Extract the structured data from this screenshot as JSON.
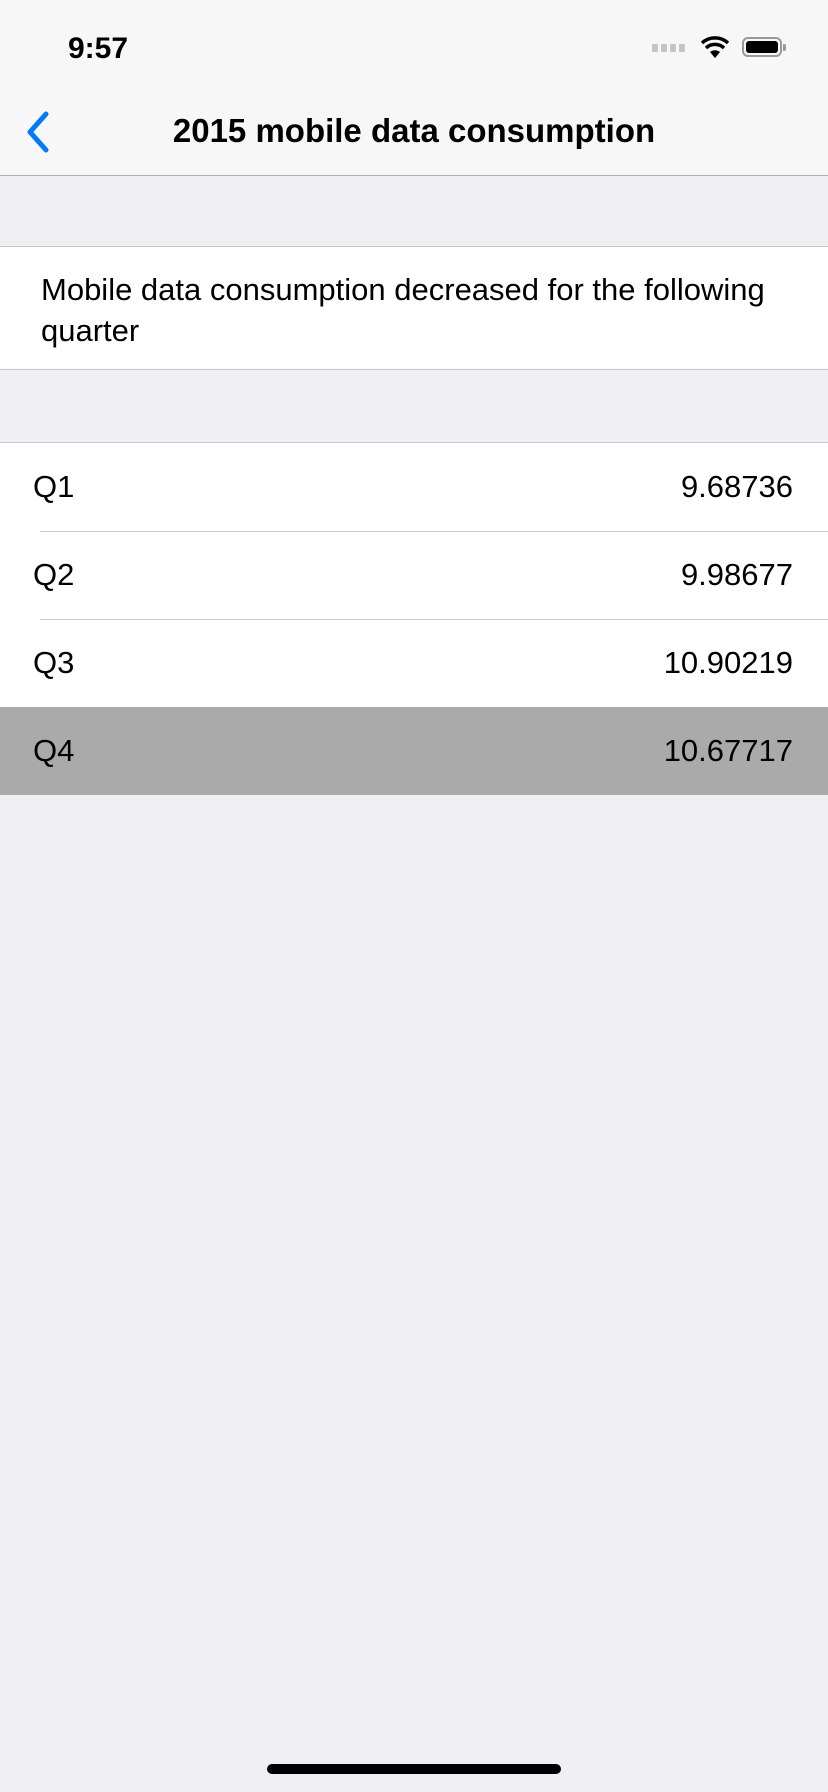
{
  "status_bar": {
    "time": "9:57"
  },
  "nav": {
    "title": "2015 mobile data consumption",
    "back_icon": "chevron-left-icon"
  },
  "description": "Mobile data consumption decreased for the following quarter",
  "rows": [
    {
      "label": "Q1",
      "value": "9.68736"
    },
    {
      "label": "Q2",
      "value": "9.98677"
    },
    {
      "label": "Q3",
      "value": "10.90219"
    },
    {
      "label": "Q4",
      "value": "10.67717",
      "selected": true
    }
  ],
  "colors": {
    "accent": "#007aff",
    "selected_row": "#aaaaaa",
    "background": "#efeff4"
  }
}
